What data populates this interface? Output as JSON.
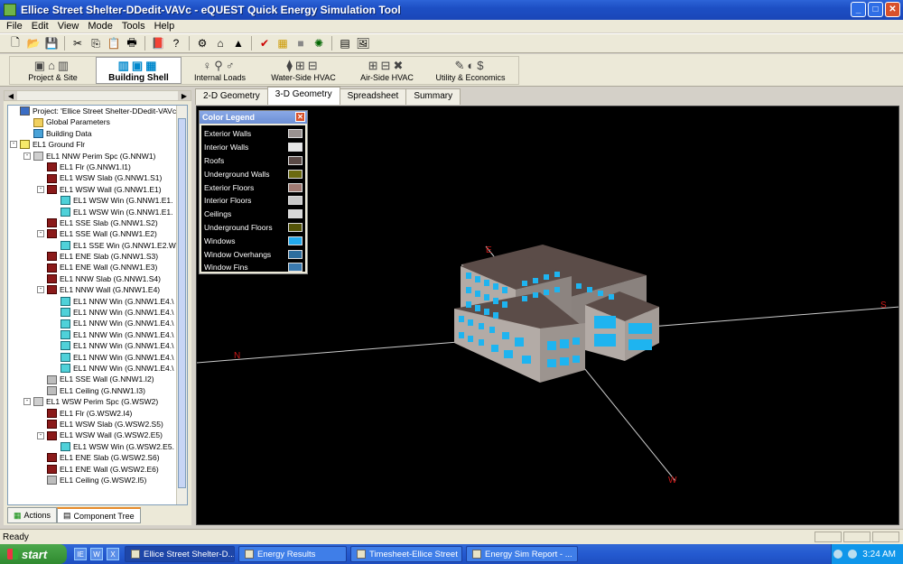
{
  "window": {
    "title": "Ellice Street Shelter-DDedit-VAVc - eQUEST Quick Energy Simulation Tool",
    "minimize": "_",
    "maximize": "□",
    "close": "✕"
  },
  "menu": [
    "File",
    "Edit",
    "View",
    "Mode",
    "Tools",
    "Help"
  ],
  "toolbar_icons": [
    "new-icon",
    "open-icon",
    "save-icon",
    "cut-icon",
    "copy-icon",
    "paste-icon",
    "print-icon",
    "help-book-icon",
    "help-icon",
    "wizard-icon",
    "building-icon",
    "run-icon",
    "check-icon",
    "grid-icon",
    "box-icon",
    "gear-icon",
    "sheet-icon",
    "image-icon"
  ],
  "modules": [
    {
      "label": "Project & Site",
      "active": false
    },
    {
      "label": "Building Shell",
      "active": true
    },
    {
      "label": "Internal Loads",
      "active": false
    },
    {
      "label": "Water-Side HVAC",
      "active": false
    },
    {
      "label": "Air-Side HVAC",
      "active": false
    },
    {
      "label": "Utility & Economics",
      "active": false
    }
  ],
  "tree": [
    {
      "depth": 0,
      "label": "Project: 'Ellice Street Shelter-DDedit-VAVc'",
      "icon": "proj",
      "exp": ""
    },
    {
      "depth": 1,
      "label": "Global Parameters",
      "icon": "folder",
      "exp": ""
    },
    {
      "depth": 1,
      "label": "Building Data",
      "icon": "db",
      "exp": ""
    },
    {
      "depth": 0,
      "label": "EL1 Ground Flr",
      "icon": "flr",
      "exp": "-"
    },
    {
      "depth": 1,
      "label": "EL1 NNW Perim Spc (G.NNW1)",
      "icon": "spc",
      "exp": "-"
    },
    {
      "depth": 2,
      "label": "EL1 Flr (G.NNW1.I1)",
      "icon": "red",
      "exp": ""
    },
    {
      "depth": 2,
      "label": "EL1 WSW Slab (G.NNW1.S1)",
      "icon": "red",
      "exp": ""
    },
    {
      "depth": 2,
      "label": "EL1 WSW Wall (G.NNW1.E1)",
      "icon": "red",
      "exp": "-"
    },
    {
      "depth": 3,
      "label": "EL1 WSW Win (G.NNW1.E1.",
      "icon": "win",
      "exp": ""
    },
    {
      "depth": 3,
      "label": "EL1 WSW Win (G.NNW1.E1.",
      "icon": "win",
      "exp": ""
    },
    {
      "depth": 2,
      "label": "EL1 SSE Slab (G.NNW1.S2)",
      "icon": "red",
      "exp": ""
    },
    {
      "depth": 2,
      "label": "EL1 SSE Wall (G.NNW1.E2)",
      "icon": "red",
      "exp": "-"
    },
    {
      "depth": 3,
      "label": "EL1 SSE Win (G.NNW1.E2.W",
      "icon": "win",
      "exp": ""
    },
    {
      "depth": 2,
      "label": "EL1 ENE Slab (G.NNW1.S3)",
      "icon": "red",
      "exp": ""
    },
    {
      "depth": 2,
      "label": "EL1 ENE Wall (G.NNW1.E3)",
      "icon": "red",
      "exp": ""
    },
    {
      "depth": 2,
      "label": "EL1 NNW Slab (G.NNW1.S4)",
      "icon": "red",
      "exp": ""
    },
    {
      "depth": 2,
      "label": "EL1 NNW Wall (G.NNW1.E4)",
      "icon": "red",
      "exp": "-"
    },
    {
      "depth": 3,
      "label": "EL1 NNW Win (G.NNW1.E4.\\",
      "icon": "win",
      "exp": ""
    },
    {
      "depth": 3,
      "label": "EL1 NNW Win (G.NNW1.E4.\\",
      "icon": "win",
      "exp": ""
    },
    {
      "depth": 3,
      "label": "EL1 NNW Win (G.NNW1.E4.\\",
      "icon": "win",
      "exp": ""
    },
    {
      "depth": 3,
      "label": "EL1 NNW Win (G.NNW1.E4.\\",
      "icon": "win",
      "exp": ""
    },
    {
      "depth": 3,
      "label": "EL1 NNW Win (G.NNW1.E4.\\",
      "icon": "win",
      "exp": ""
    },
    {
      "depth": 3,
      "label": "EL1 NNW Win (G.NNW1.E4.\\",
      "icon": "win",
      "exp": ""
    },
    {
      "depth": 3,
      "label": "EL1 NNW Win (G.NNW1.E4.\\",
      "icon": "win",
      "exp": ""
    },
    {
      "depth": 2,
      "label": "EL1 SSE Wall (G.NNW1.I2)",
      "icon": "int",
      "exp": ""
    },
    {
      "depth": 2,
      "label": "EL1 Ceiling (G.NNW1.I3)",
      "icon": "int",
      "exp": ""
    },
    {
      "depth": 1,
      "label": "EL1 WSW Perim Spc (G.WSW2)",
      "icon": "spc",
      "exp": "-"
    },
    {
      "depth": 2,
      "label": "EL1 Flr (G.WSW2.I4)",
      "icon": "red",
      "exp": ""
    },
    {
      "depth": 2,
      "label": "EL1 WSW Slab (G.WSW2.S5)",
      "icon": "red",
      "exp": ""
    },
    {
      "depth": 2,
      "label": "EL1 WSW Wall (G.WSW2.E5)",
      "icon": "red",
      "exp": "-"
    },
    {
      "depth": 3,
      "label": "EL1 WSW Win (G.WSW2.E5.",
      "icon": "win",
      "exp": ""
    },
    {
      "depth": 2,
      "label": "EL1 ENE Slab (G.WSW2.S6)",
      "icon": "red",
      "exp": ""
    },
    {
      "depth": 2,
      "label": "EL1 ENE Wall (G.WSW2.E6)",
      "icon": "red",
      "exp": ""
    },
    {
      "depth": 2,
      "label": "EL1 Ceiling (G.WSW2.I5)",
      "icon": "int",
      "exp": ""
    }
  ],
  "panel_tabs": [
    {
      "label": "Actions",
      "active": false
    },
    {
      "label": "Component Tree",
      "active": true
    }
  ],
  "view_tabs": [
    {
      "label": "2-D Geometry",
      "active": false
    },
    {
      "label": "3-D Geometry",
      "active": true
    },
    {
      "label": "Spreadsheet",
      "active": false
    },
    {
      "label": "Summary",
      "active": false
    }
  ],
  "legend": {
    "title": "Color Legend",
    "close": "✕",
    "items": [
      {
        "label": "Exterior Walls",
        "color": "#9a9290"
      },
      {
        "label": "Interior Walls",
        "color": "#e6e6e6"
      },
      {
        "label": "Roofs",
        "color": "#5a4a46"
      },
      {
        "label": "Underground Walls",
        "color": "#6b6a10"
      },
      {
        "label": "Exterior Floors",
        "color": "#a07a72"
      },
      {
        "label": "Interior Floors",
        "color": "#c8c8c8"
      },
      {
        "label": "Ceilings",
        "color": "#d8d8d8"
      },
      {
        "label": "Underground Floors",
        "color": "#545408"
      },
      {
        "label": "Windows",
        "color": "#22aaee"
      },
      {
        "label": "Window Overhangs",
        "color": "#2e6e9e"
      },
      {
        "label": "Window Fins",
        "color": "#3a7ab0"
      }
    ]
  },
  "compass": {
    "north": "N",
    "south": "S",
    "east": "E",
    "west": "W"
  },
  "status": "Ready",
  "taskbar": {
    "start": "start",
    "quicklaunch": [
      "IE",
      "W",
      "X"
    ],
    "tasks": [
      {
        "label": "Ellice Street Shelter-D...",
        "active": true
      },
      {
        "label": "Energy Results",
        "active": false
      },
      {
        "label": "Timesheet-Ellice Street",
        "active": false
      },
      {
        "label": "Energy Sim Report - ...",
        "active": false
      }
    ],
    "clock": "3:24 AM"
  }
}
